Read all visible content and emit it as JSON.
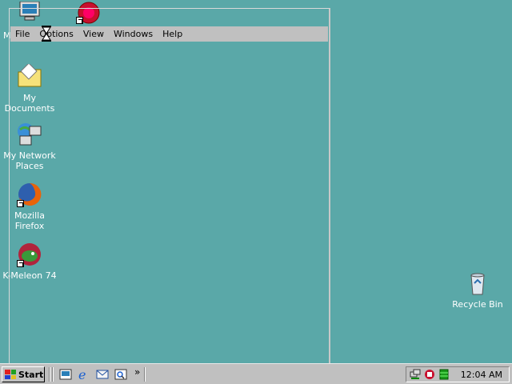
{
  "desktop": {
    "icons": [
      {
        "label": "My Computer",
        "icon": "computer-icon"
      },
      {
        "label": "",
        "icon": "shortcut-red-icon"
      },
      {
        "label": "My Documents",
        "icon": "folder-icon"
      },
      {
        "label": "My Network Places",
        "icon": "network-icon"
      },
      {
        "label": "Mozilla Firefox",
        "icon": "firefox-icon"
      },
      {
        "label": "K-Meleon 74",
        "icon": "kmeleon-icon"
      },
      {
        "label": "Recycle Bin",
        "icon": "recycle-bin-icon"
      }
    ]
  },
  "window": {
    "menu": [
      "File",
      "Options",
      "View",
      "Windows",
      "Help"
    ]
  },
  "taskbar": {
    "start_label": "Start",
    "quick_launch": [
      "show-desktop-icon",
      "internet-explorer-icon",
      "outlook-express-icon",
      "search-icon"
    ],
    "chevron": "»",
    "clock": "12:04 AM",
    "tray_icons": [
      "network-tray-icon",
      "volume-tray-icon",
      "monitor-tray-icon"
    ]
  },
  "colors": {
    "desktop": "#5aa8a8",
    "taskbar": "#c0c0c0"
  }
}
